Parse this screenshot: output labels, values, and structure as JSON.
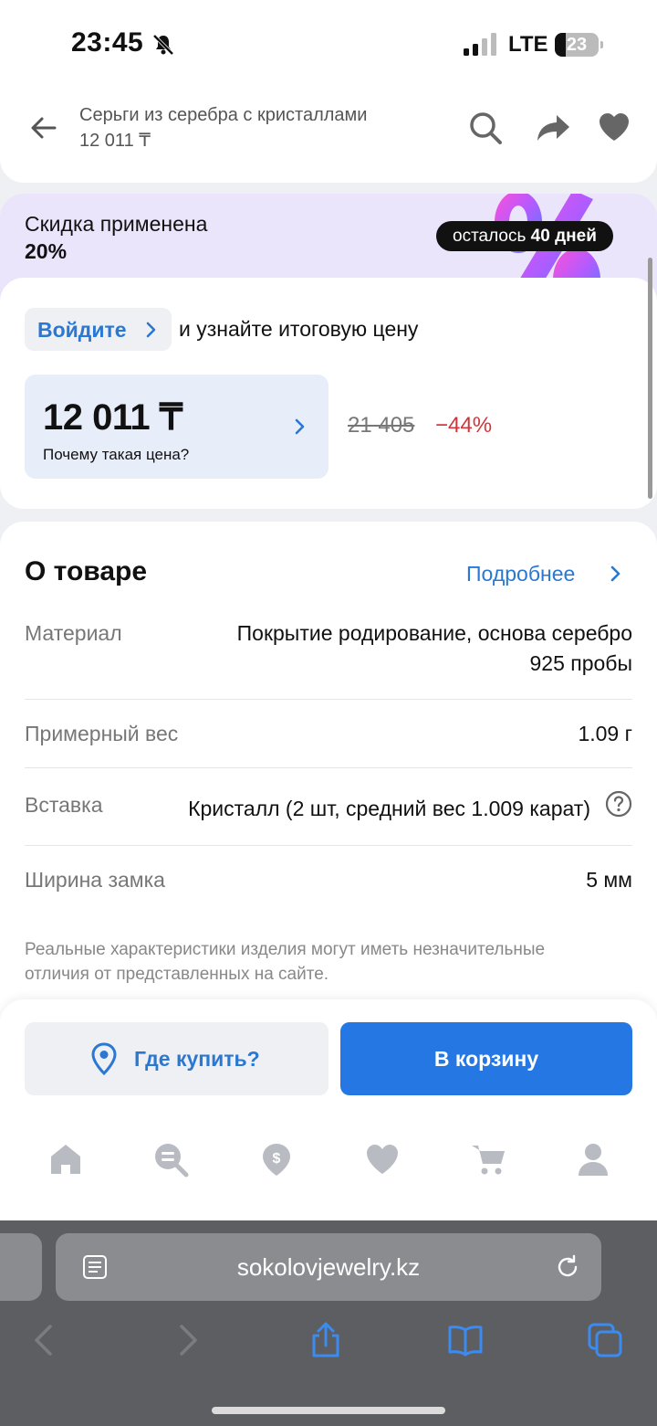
{
  "status_bar": {
    "time": "23:45",
    "network": "LTE",
    "battery": "23"
  },
  "header": {
    "title": "Серьги из серебра с кристаллами",
    "price": "12 011 ₸"
  },
  "discount": {
    "title": "Скидка применена",
    "value": "20%",
    "days_prefix": "осталось",
    "days_value": "40 дней"
  },
  "price_card": {
    "login_label": "Войдите",
    "login_suffix": "и узнайте итоговую цену",
    "price": "12 011 ₸",
    "why_label": "Почему такая цена?",
    "old_price": "21 405",
    "discount_percent": "−44%"
  },
  "about": {
    "title": "О товаре",
    "more_label": "Подробнее",
    "specs": [
      {
        "label": "Материал",
        "value_line1": "Покрытие родирование, основа серебро",
        "value_line2": "925 пробы"
      },
      {
        "label": "Примерный вес",
        "value": "1.09 г"
      },
      {
        "label": "Вставка",
        "value": "Кристалл (2 шт, средний вес 1.009 карат)"
      },
      {
        "label": "Ширина замка",
        "value": "5 мм"
      }
    ],
    "disclaimer": "Реальные характеристики изделия могут иметь незначительные отличия от представленных на сайте."
  },
  "actions": {
    "where_label": "Где купить?",
    "cart_label": "В корзину"
  },
  "tab_bar": {
    "items": [
      "home-icon",
      "search-catalog-icon",
      "bonus-icon",
      "favorites-icon",
      "cart-icon",
      "profile-icon"
    ],
    "icon_color": "#b8bcc2"
  },
  "safari": {
    "url": "sokolovjewelry.kz"
  },
  "colors": {
    "accent": "#2a78d2",
    "cart_button": "#2578e3",
    "discount_red": "#d2353b",
    "banner_bg": "#ebe5fc"
  }
}
